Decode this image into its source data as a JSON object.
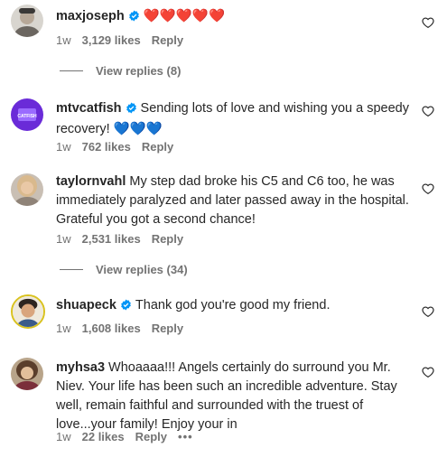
{
  "comments": [
    {
      "username": "maxjoseph",
      "verified": true,
      "text": "",
      "emoji": "❤️❤️❤️❤️❤️",
      "age": "1w",
      "likes": "3,129 likes",
      "reply": "Reply",
      "view_replies": "View replies (8)"
    },
    {
      "username": "mtvcatfish",
      "verified": true,
      "text": "Sending lots of love and wishing you a speedy recovery!",
      "emoji": "💙💙💙",
      "age": "1w",
      "likes": "762 likes",
      "reply": "Reply",
      "avatar_label": "CATFISH"
    },
    {
      "username": "taylornvahl",
      "verified": false,
      "text": "My step dad broke his C5 and C6 too, he was immediately paralyzed and later passed away in the hospital. Grateful you got a second chance!",
      "age": "1w",
      "likes": "2,531 likes",
      "reply": "Reply",
      "view_replies": "View replies (34)"
    },
    {
      "username": "shuapeck",
      "verified": true,
      "text": "Thank god you're good my friend.",
      "age": "1w",
      "likes": "1,608 likes",
      "reply": "Reply"
    },
    {
      "username": "myhsa3",
      "verified": false,
      "text": "Whoaaaa!!! Angels certainly do surround you Mr. Niev. Your life has been such an incredible adventure. Stay well, remain faithful and surrounded with the truest of love...your family! Enjoy your in",
      "age": "1w",
      "likes": "22 likes",
      "reply": "Reply",
      "more": "•••"
    }
  ],
  "colors": {
    "text": "#262626",
    "secondary": "#737373",
    "verified": "#0095f6"
  },
  "icons": {
    "like": "heart-outline-icon",
    "verified": "verified-badge-icon",
    "more": "more-options-icon"
  }
}
